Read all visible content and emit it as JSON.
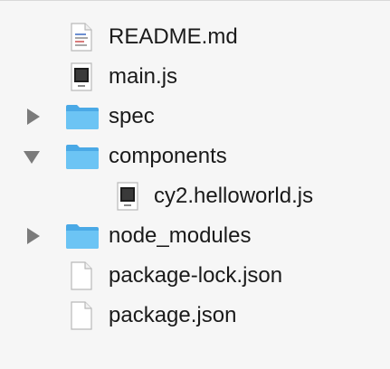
{
  "file_list": {
    "rows": [
      {
        "label": "README.md",
        "icon": "markdown-file-icon",
        "disclosure": "none"
      },
      {
        "label": "main.js",
        "icon": "js-file-icon",
        "disclosure": "none"
      },
      {
        "label": "spec",
        "icon": "folder-icon",
        "disclosure": "collapsed"
      },
      {
        "label": "components",
        "icon": "folder-icon",
        "disclosure": "expanded"
      },
      {
        "label": "cy2.helloworld.js",
        "icon": "js-file-icon",
        "disclosure": "none"
      },
      {
        "label": "node_modules",
        "icon": "folder-icon",
        "disclosure": "collapsed"
      },
      {
        "label": "package-lock.json",
        "icon": "json-file-icon",
        "disclosure": "none"
      },
      {
        "label": "package.json",
        "icon": "json-file-icon",
        "disclosure": "none"
      }
    ]
  },
  "colors": {
    "folder_blue": "#5ebdf2",
    "disclosure_gray": "#7b7b7b",
    "background": "#f6f6f6"
  }
}
